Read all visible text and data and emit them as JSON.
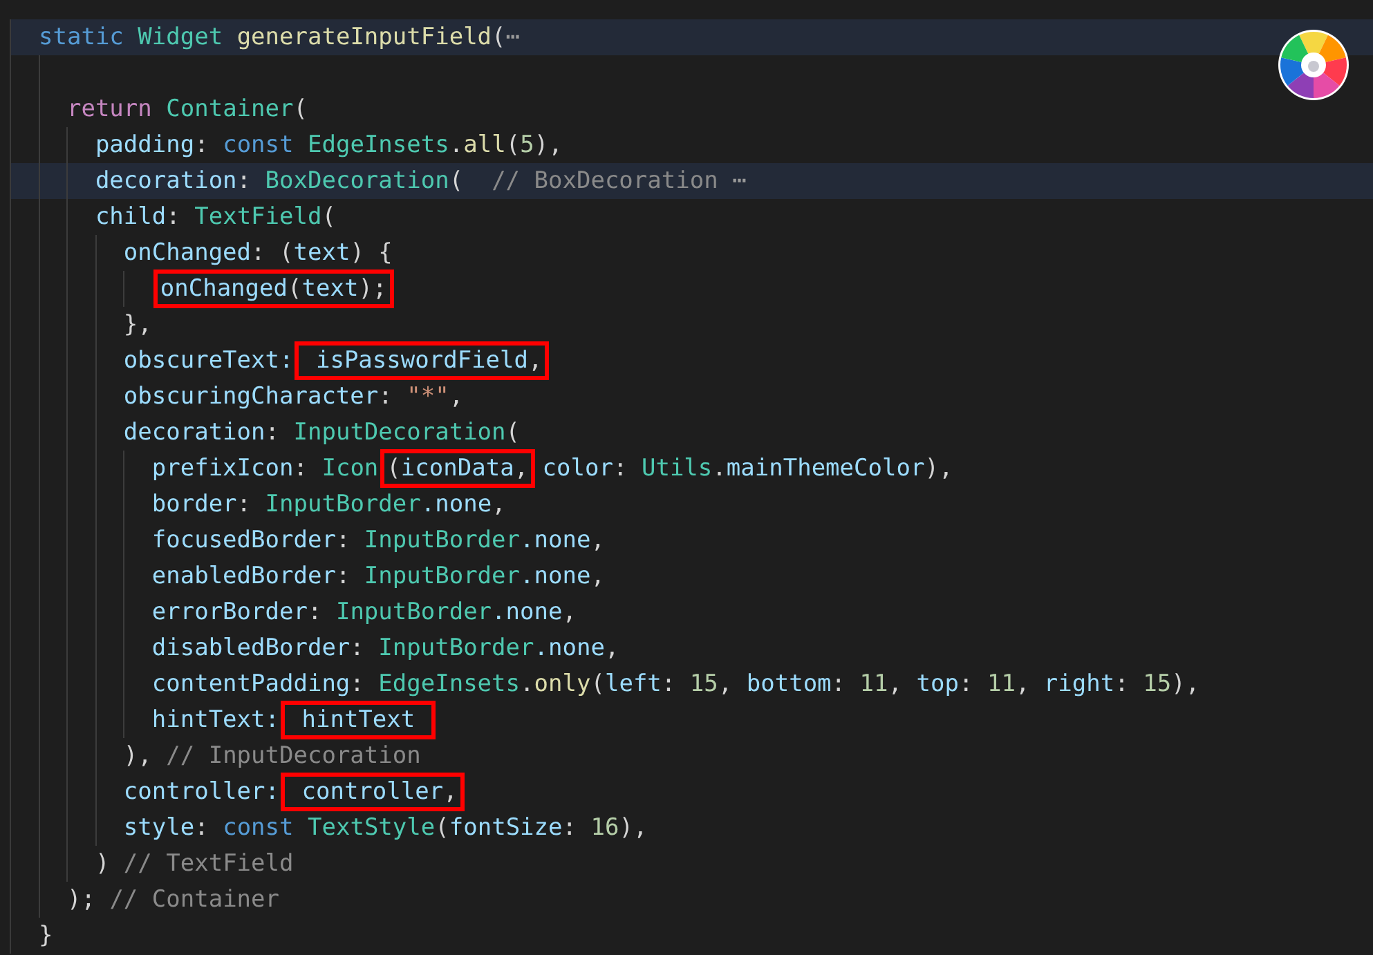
{
  "editor": {
    "lines": [
      {
        "highlighted": true,
        "tokens": [
          {
            "kind": "keyword",
            "text": "static "
          },
          {
            "kind": "type",
            "text": "Widget "
          },
          {
            "kind": "function",
            "text": "generateInputField"
          },
          {
            "kind": "plain",
            "text": "("
          },
          {
            "kind": "fold",
            "text": "⋯"
          }
        ],
        "children": [
          {
            "highlighted": false
          },
          {
            "highlighted": false,
            "tokens": [
              {
                "kind": "control",
                "text": "return "
              },
              {
                "kind": "type",
                "text": "Container"
              },
              {
                "kind": "plain",
                "text": "("
              }
            ],
            "children": [
              {
                "highlighted": false,
                "tokens": [
                  {
                    "kind": "property",
                    "text": "padding"
                  },
                  {
                    "kind": "plain",
                    "text": ": "
                  },
                  {
                    "kind": "keyword",
                    "text": "const "
                  },
                  {
                    "kind": "type",
                    "text": "EdgeInsets"
                  },
                  {
                    "kind": "plain",
                    "text": "."
                  },
                  {
                    "kind": "function",
                    "text": "all"
                  },
                  {
                    "kind": "plain",
                    "text": "("
                  },
                  {
                    "kind": "number",
                    "text": "5"
                  },
                  {
                    "kind": "plain",
                    "text": "),"
                  }
                ]
              },
              {
                "highlighted": true,
                "tokens": [
                  {
                    "kind": "property",
                    "text": "decoration"
                  },
                  {
                    "kind": "plain",
                    "text": ": "
                  },
                  {
                    "kind": "type",
                    "text": "BoxDecoration"
                  },
                  {
                    "kind": "plain",
                    "text": "(  "
                  },
                  {
                    "kind": "comment",
                    "text": "// BoxDecoration"
                  },
                  {
                    "kind": "fold",
                    "text": " ⋯"
                  }
                ]
              },
              {
                "highlighted": false,
                "tokens": [
                  {
                    "kind": "property",
                    "text": "child"
                  },
                  {
                    "kind": "plain",
                    "text": ": "
                  },
                  {
                    "kind": "type",
                    "text": "TextField"
                  },
                  {
                    "kind": "plain",
                    "text": "("
                  }
                ],
                "children": [
                  {
                    "highlighted": false,
                    "tokens": [
                      {
                        "kind": "property",
                        "text": "onChanged"
                      },
                      {
                        "kind": "plain",
                        "text": ": ("
                      },
                      {
                        "kind": "property",
                        "text": "text"
                      },
                      {
                        "kind": "plain",
                        "text": ") {"
                      }
                    ],
                    "children": [
                      {
                        "highlighted": false,
                        "tokens": [
                          {
                            "kind": "box",
                            "tokens": [
                              {
                                "kind": "property",
                                "text": "onChanged"
                              },
                              {
                                "kind": "plain",
                                "text": "("
                              },
                              {
                                "kind": "property",
                                "text": "text"
                              },
                              {
                                "kind": "plain",
                                "text": ");"
                              }
                            ]
                          }
                        ]
                      }
                    ]
                  },
                  {
                    "highlighted": false,
                    "tokens": [
                      {
                        "kind": "plain",
                        "text": "},"
                      }
                    ]
                  },
                  {
                    "highlighted": false,
                    "tokens": [
                      {
                        "kind": "property",
                        "text": "obscureText:"
                      },
                      {
                        "kind": "box",
                        "tokens": [
                          {
                            "kind": "property",
                            "text": " isPasswordField"
                          },
                          {
                            "kind": "plain",
                            "text": ","
                          }
                        ]
                      }
                    ]
                  },
                  {
                    "highlighted": false,
                    "tokens": [
                      {
                        "kind": "property",
                        "text": "obscuringCharacter"
                      },
                      {
                        "kind": "plain",
                        "text": ": "
                      },
                      {
                        "kind": "string",
                        "text": "\"*\""
                      },
                      {
                        "kind": "plain",
                        "text": ","
                      }
                    ]
                  },
                  {
                    "highlighted": false,
                    "tokens": [
                      {
                        "kind": "property",
                        "text": "decoration"
                      },
                      {
                        "kind": "plain",
                        "text": ": "
                      },
                      {
                        "kind": "type",
                        "text": "InputDecoration"
                      },
                      {
                        "kind": "plain",
                        "text": "("
                      }
                    ],
                    "children": [
                      {
                        "highlighted": false,
                        "tokens": [
                          {
                            "kind": "property",
                            "text": "prefixIcon"
                          },
                          {
                            "kind": "plain",
                            "text": ": "
                          },
                          {
                            "kind": "type",
                            "text": "Icon"
                          },
                          {
                            "kind": "box",
                            "tokens": [
                              {
                                "kind": "plain",
                                "text": "("
                              },
                              {
                                "kind": "property",
                                "text": "iconData"
                              },
                              {
                                "kind": "plain",
                                "text": ","
                              }
                            ]
                          },
                          {
                            "kind": "property",
                            "text": " color"
                          },
                          {
                            "kind": "plain",
                            "text": ": "
                          },
                          {
                            "kind": "type",
                            "text": "Utils"
                          },
                          {
                            "kind": "plain",
                            "text": "."
                          },
                          {
                            "kind": "property",
                            "text": "mainThemeColor"
                          },
                          {
                            "kind": "plain",
                            "text": "),"
                          }
                        ]
                      },
                      {
                        "highlighted": false,
                        "tokens": [
                          {
                            "kind": "property",
                            "text": "border"
                          },
                          {
                            "kind": "plain",
                            "text": ": "
                          },
                          {
                            "kind": "type",
                            "text": "InputBorder"
                          },
                          {
                            "kind": "property",
                            "text": ".none"
                          },
                          {
                            "kind": "plain",
                            "text": ","
                          }
                        ]
                      },
                      {
                        "highlighted": false,
                        "tokens": [
                          {
                            "kind": "property",
                            "text": "focusedBorder"
                          },
                          {
                            "kind": "plain",
                            "text": ": "
                          },
                          {
                            "kind": "type",
                            "text": "InputBorder"
                          },
                          {
                            "kind": "property",
                            "text": ".none"
                          },
                          {
                            "kind": "plain",
                            "text": ","
                          }
                        ]
                      },
                      {
                        "highlighted": false,
                        "tokens": [
                          {
                            "kind": "property",
                            "text": "enabledBorder"
                          },
                          {
                            "kind": "plain",
                            "text": ": "
                          },
                          {
                            "kind": "type",
                            "text": "InputBorder"
                          },
                          {
                            "kind": "property",
                            "text": ".none"
                          },
                          {
                            "kind": "plain",
                            "text": ","
                          }
                        ]
                      },
                      {
                        "highlighted": false,
                        "tokens": [
                          {
                            "kind": "property",
                            "text": "errorBorder"
                          },
                          {
                            "kind": "plain",
                            "text": ": "
                          },
                          {
                            "kind": "type",
                            "text": "InputBorder"
                          },
                          {
                            "kind": "property",
                            "text": ".none"
                          },
                          {
                            "kind": "plain",
                            "text": ","
                          }
                        ]
                      },
                      {
                        "highlighted": false,
                        "tokens": [
                          {
                            "kind": "property",
                            "text": "disabledBorder"
                          },
                          {
                            "kind": "plain",
                            "text": ": "
                          },
                          {
                            "kind": "type",
                            "text": "InputBorder"
                          },
                          {
                            "kind": "property",
                            "text": ".none"
                          },
                          {
                            "kind": "plain",
                            "text": ","
                          }
                        ]
                      },
                      {
                        "highlighted": false,
                        "tokens": [
                          {
                            "kind": "property",
                            "text": "contentPadding"
                          },
                          {
                            "kind": "plain",
                            "text": ": "
                          },
                          {
                            "kind": "type",
                            "text": "EdgeInsets"
                          },
                          {
                            "kind": "plain",
                            "text": "."
                          },
                          {
                            "kind": "function",
                            "text": "only"
                          },
                          {
                            "kind": "plain",
                            "text": "("
                          },
                          {
                            "kind": "property",
                            "text": "left"
                          },
                          {
                            "kind": "plain",
                            "text": ": "
                          },
                          {
                            "kind": "number",
                            "text": "15"
                          },
                          {
                            "kind": "plain",
                            "text": ", "
                          },
                          {
                            "kind": "property",
                            "text": "bottom"
                          },
                          {
                            "kind": "plain",
                            "text": ": "
                          },
                          {
                            "kind": "number",
                            "text": "11"
                          },
                          {
                            "kind": "plain",
                            "text": ", "
                          },
                          {
                            "kind": "property",
                            "text": "top"
                          },
                          {
                            "kind": "plain",
                            "text": ": "
                          },
                          {
                            "kind": "number",
                            "text": "11"
                          },
                          {
                            "kind": "plain",
                            "text": ", "
                          },
                          {
                            "kind": "property",
                            "text": "right"
                          },
                          {
                            "kind": "plain",
                            "text": ": "
                          },
                          {
                            "kind": "number",
                            "text": "15"
                          },
                          {
                            "kind": "plain",
                            "text": "),"
                          }
                        ]
                      },
                      {
                        "highlighted": false,
                        "tokens": [
                          {
                            "kind": "property",
                            "text": "hintText:"
                          },
                          {
                            "kind": "box",
                            "tokens": [
                              {
                                "kind": "property",
                                "text": " hintText "
                              }
                            ]
                          }
                        ]
                      }
                    ]
                  },
                  {
                    "highlighted": false,
                    "tokens": [
                      {
                        "kind": "plain",
                        "text": "), "
                      },
                      {
                        "kind": "comment",
                        "text": "// InputDecoration"
                      }
                    ]
                  },
                  {
                    "highlighted": false,
                    "tokens": [
                      {
                        "kind": "property",
                        "text": "controller:"
                      },
                      {
                        "kind": "box",
                        "tokens": [
                          {
                            "kind": "property",
                            "text": " controller"
                          },
                          {
                            "kind": "plain",
                            "text": ","
                          }
                        ]
                      }
                    ]
                  },
                  {
                    "highlighted": false,
                    "tokens": [
                      {
                        "kind": "property",
                        "text": "style"
                      },
                      {
                        "kind": "plain",
                        "text": ": "
                      },
                      {
                        "kind": "keyword",
                        "text": "const "
                      },
                      {
                        "kind": "type",
                        "text": "TextStyle"
                      },
                      {
                        "kind": "plain",
                        "text": "("
                      },
                      {
                        "kind": "property",
                        "text": "fontSize"
                      },
                      {
                        "kind": "plain",
                        "text": ": "
                      },
                      {
                        "kind": "number",
                        "text": "16"
                      },
                      {
                        "kind": "plain",
                        "text": "),"
                      }
                    ]
                  }
                ]
              },
              {
                "highlighted": false,
                "tokens": [
                  {
                    "kind": "plain",
                    "text": ") "
                  },
                  {
                    "kind": "comment",
                    "text": "// TextField"
                  }
                ]
              }
            ]
          },
          {
            "highlighted": false,
            "tokens": [
              {
                "kind": "plain",
                "text": "); "
              },
              {
                "kind": "comment",
                "text": "// Container"
              }
            ]
          }
        ]
      },
      {
        "highlighted": false,
        "tokens": [
          {
            "kind": "plain",
            "text": "}"
          }
        ]
      }
    ]
  }
}
